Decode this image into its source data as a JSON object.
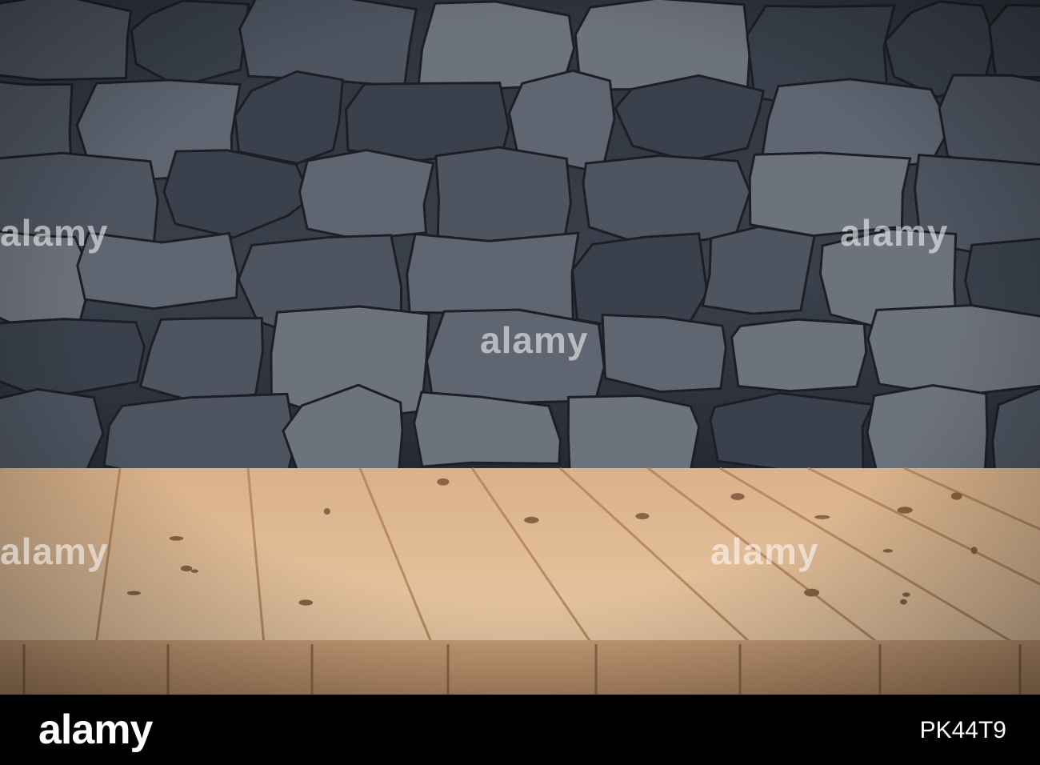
{
  "scene": {
    "wall_colors": [
      "#3a414c",
      "#4e5561",
      "#5f6672",
      "#6d737c"
    ],
    "table_colors": {
      "light": "#e8c49f",
      "mid": "#d9b18a",
      "dark": "#c29670",
      "edge": "#b78a62"
    }
  },
  "watermarks": {
    "left": "alamy",
    "right": "alamy",
    "center": "alamy",
    "bottom_left": "alamy",
    "bottom_right": "alamy"
  },
  "footer": {
    "logo": "alamy",
    "image_id": "PK44T9"
  }
}
